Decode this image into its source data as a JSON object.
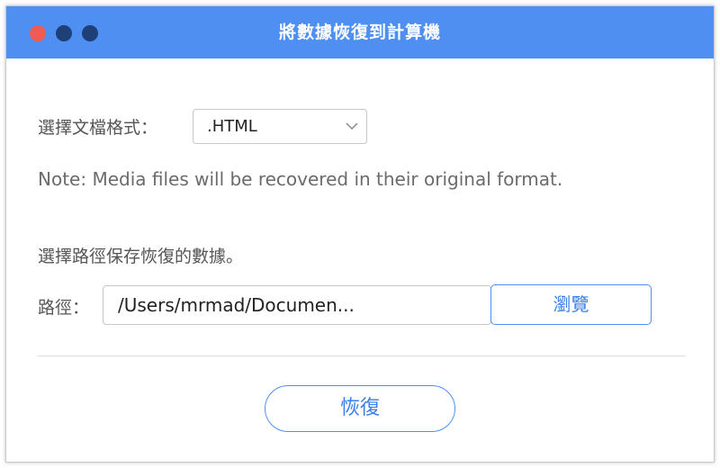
{
  "window": {
    "title": "將數據恢復到計算機"
  },
  "format": {
    "label": "選擇文檔格式：",
    "selected": ".HTML"
  },
  "note": "Note: Media files will be recovered in their original format.",
  "path": {
    "caption": "選擇路徑保存恢復的數據。",
    "label": "路徑：",
    "value": "/Users/mrmad/Documen...",
    "browse_label": "瀏覽"
  },
  "actions": {
    "recover_label": "恢復"
  },
  "colors": {
    "titlebar": "#4f8ff2",
    "accent": "#3a7ee6",
    "close": "#f05b55"
  },
  "icons": {
    "select_arrow": "chevron-down-icon"
  }
}
